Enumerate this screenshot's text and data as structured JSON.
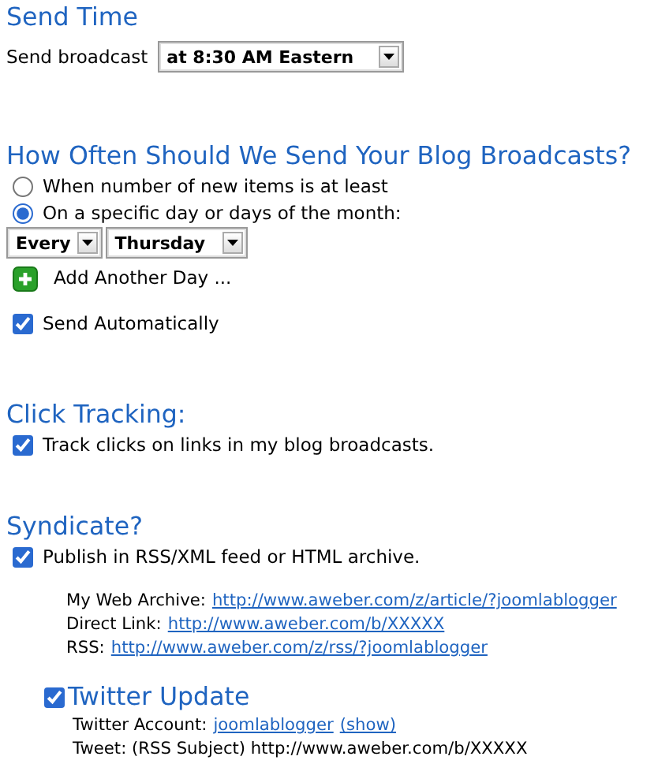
{
  "send_time": {
    "heading": "Send Time",
    "label": "Send broadcast",
    "dropdown": "at 8:30 AM Eastern"
  },
  "frequency": {
    "heading": "How Often Should We Send Your Blog Broadcasts?",
    "options": [
      {
        "label": "When number of new items is at least",
        "selected": false
      },
      {
        "label": "On a specific day or days of the month:",
        "selected": true
      }
    ],
    "dropdowns": [
      "Every",
      "Thursday"
    ],
    "add_day": "Add Another Day ...",
    "send_automatically": {
      "label": "Send Automatically",
      "checked": true
    }
  },
  "click_tracking": {
    "heading": "Click Tracking:",
    "option": {
      "label": "Track clicks on links in my blog broadcasts.",
      "checked": true
    }
  },
  "syndicate": {
    "heading": "Syndicate?",
    "option": {
      "label": "Publish in RSS/XML feed or HTML archive.",
      "checked": true
    },
    "links": [
      {
        "label": "My Web Archive:",
        "url": "http://www.aweber.com/z/article/?joomlablogger"
      },
      {
        "label": "Direct Link:",
        "url": "http://www.aweber.com/b/XXXXX"
      },
      {
        "label": "RSS:",
        "url": "http://www.aweber.com/z/rss/?joomlablogger"
      }
    ],
    "twitter": {
      "heading": "Twitter Update",
      "checked": true,
      "account_label": "Twitter Account:",
      "account": "joomlablogger",
      "show": "(show)",
      "tweet": "Tweet: (RSS Subject) http://www.aweber.com/b/XXXXX"
    }
  }
}
